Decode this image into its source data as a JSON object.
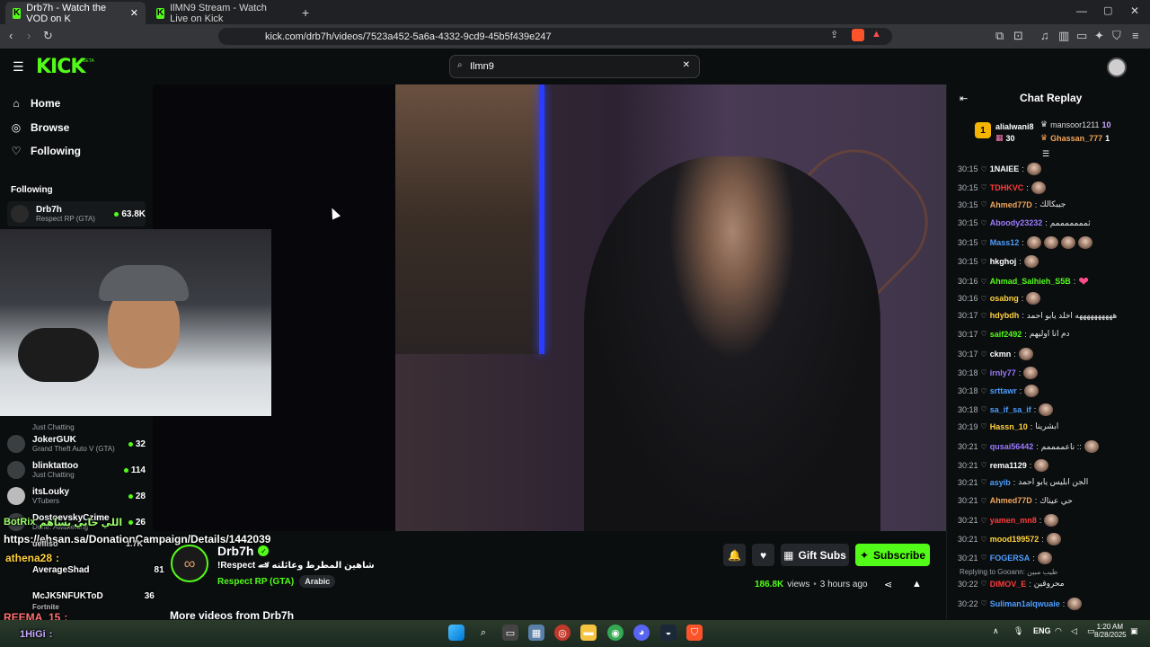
{
  "browser": {
    "tabs": [
      {
        "title": "Drb7h - Watch the VOD on K",
        "active": true
      },
      {
        "title": "IlMN9 Stream - Watch Live on Kick",
        "active": false
      }
    ],
    "url": "kick.com/drb7h/videos/7523a452-5a6a-4332-9cd9-45b5f439e247"
  },
  "header": {
    "logo": "KICK",
    "logo_badge": "BETA",
    "search_value": "Ilmn9"
  },
  "sidebar": {
    "nav": [
      {
        "label": "Home",
        "icon": "home-icon"
      },
      {
        "label": "Browse",
        "icon": "compass-icon"
      },
      {
        "label": "Following",
        "icon": "heart-icon"
      }
    ],
    "following_heading": "Following",
    "channels_top": [
      {
        "name": "Drb7h",
        "game": "Respect RP (GTA)",
        "viewers": "63.8K"
      }
    ],
    "channels": [
      {
        "name": "",
        "game": "Just Chatting",
        "viewers": ""
      },
      {
        "name": "JokerGUK",
        "game": "Grand Theft Auto V (GTA)",
        "viewers": "32"
      },
      {
        "name": "blinktattoo",
        "game": "Just Chatting",
        "viewers": "114"
      },
      {
        "name": "itsLouky",
        "game": "VTubers",
        "viewers": "28"
      },
      {
        "name": "DostoevskyCzime",
        "game": "Dune: Awakening",
        "viewers": "26"
      }
    ]
  },
  "overlay": {
    "donation_url": "https://ehsan.sa/DonationCampaign/Details/1442039",
    "chat_lines": [
      {
        "user": "BotRix",
        "text": "اللي حابي يساهم"
      },
      {
        "user": "athena28",
        "text": ":"
      },
      {
        "user": "AverageShad",
        "text": "81"
      },
      {
        "user": "McJK5NFUKToD",
        "text": "36"
      },
      {
        "user": "REEMA_15",
        "text": ":"
      },
      {
        "user": "1HiGi",
        "text": ":"
      }
    ],
    "sidebar_overlap": [
      {
        "label": "uelliso",
        "value": "1.7K"
      },
      {
        "label": "Fortnite",
        "value": ""
      }
    ]
  },
  "stream": {
    "channel_name": "Drb7h",
    "verified": true,
    "title": "!Respect 🏎 شاهين المطرط وعائلته",
    "category": "Respect RP (GTA)",
    "language": "Arabic",
    "views": "186.8K",
    "views_label": "views",
    "time_ago": "3 hours ago",
    "more_videos": "More videos from Drb7h",
    "buttons": {
      "gift": "Gift Subs",
      "subscribe": "Subscribe"
    }
  },
  "chat": {
    "title": "Chat Replay",
    "leaderboard": [
      {
        "rank": "1",
        "user": "alialwani8",
        "count": "30"
      },
      {
        "rank": "",
        "user": "mansoor1211",
        "count": "10"
      },
      {
        "rank": "",
        "user": "Ghassan_777",
        "count": "1"
      }
    ],
    "messages": [
      {
        "time": "30:15",
        "user": "1NAIEE",
        "color": "#ffffff",
        "text": "",
        "emotes": 1
      },
      {
        "time": "30:15",
        "user": "TDHKVC",
        "color": "#ff3b3b",
        "text": "",
        "emotes": 1
      },
      {
        "time": "30:15",
        "user": "Ahmed77D",
        "color": "#f2a65a",
        "text": "جيبكالك",
        "emotes": 0
      },
      {
        "time": "30:15",
        "user": "Aboody23232",
        "color": "#9b7bff",
        "text": "ثمممممممم",
        "emotes": 0
      },
      {
        "time": "30:15",
        "user": "Mass12",
        "color": "#4d9dff",
        "text": "",
        "emotes": 4
      },
      {
        "time": "30:15",
        "user": "hkghoj",
        "color": "#ffffff",
        "text": "",
        "emotes": 1
      },
      {
        "time": "30:16",
        "user": "Ahmad_Salhieh_S5B",
        "color": "#53fc18",
        "text": "",
        "emotes": 0,
        "heart": true
      },
      {
        "time": "30:16",
        "user": "osabng",
        "color": "#ffd23f",
        "text": "",
        "emotes": 1
      },
      {
        "time": "30:17",
        "user": "hdybdh",
        "color": "#ffd23f",
        "text": "ههههههههههه اخلد يابو احمد",
        "emotes": 0
      },
      {
        "time": "30:17",
        "user": "saif2492",
        "color": "#53fc18",
        "text": "دم انا اوليهم",
        "emotes": 0
      },
      {
        "time": "30:17",
        "user": "ckmn",
        "color": "#ffffff",
        "text": "",
        "emotes": 1
      },
      {
        "time": "30:18",
        "user": "irnly77",
        "color": "#9b7bff",
        "text": "",
        "emotes": 1
      },
      {
        "time": "30:18",
        "user": "srttawr",
        "color": "#4d9dff",
        "text": "",
        "emotes": 1
      },
      {
        "time": "30:18",
        "user": "sa_if_sa_if",
        "color": "#4d9dff",
        "text": "",
        "emotes": 1
      },
      {
        "time": "30:19",
        "user": "Hassn_10",
        "color": "#ffd23f",
        "text": "ابشرينا",
        "emotes": 0
      },
      {
        "time": "30:21",
        "user": "qusai56442",
        "color": "#9b7bff",
        "text": "ناعممممم ::",
        "emotes": 1
      },
      {
        "time": "30:21",
        "user": "rema1129",
        "color": "#ffffff",
        "text": "",
        "emotes": 1
      },
      {
        "time": "30:21",
        "user": "asyib",
        "color": "#4d9dff",
        "text": "الجن ابليس يابو احمد",
        "emotes": 0
      },
      {
        "time": "30:21",
        "user": "Ahmed77D",
        "color": "#f2a65a",
        "text": "حي عيناك",
        "emotes": 0
      },
      {
        "time": "30:21",
        "user": "yamen_mn8",
        "color": "#ff3b3b",
        "text": "",
        "emotes": 1
      },
      {
        "time": "30:21",
        "user": "mood199572",
        "color": "#ffd23f",
        "text": "",
        "emotes": 1
      },
      {
        "time": "30:21",
        "user": "FOGERSA",
        "color": "#4d9dff",
        "text": "",
        "emotes": 1
      }
    ],
    "reply_note": "Replying to Gooann: طيب مبين",
    "tail": [
      {
        "time": "30:22",
        "user": "DIMOV_E",
        "color": "#ff3b3b",
        "text": "محروقين",
        "emotes": 0
      },
      {
        "time": "30:22",
        "user": "Suliman1alqwuaie",
        "color": "#4d9dff",
        "text": "",
        "emotes": 1
      }
    ]
  },
  "taskbar": {
    "lang": "ENG",
    "time": "1:20 AM",
    "date": "8/28/2025"
  }
}
